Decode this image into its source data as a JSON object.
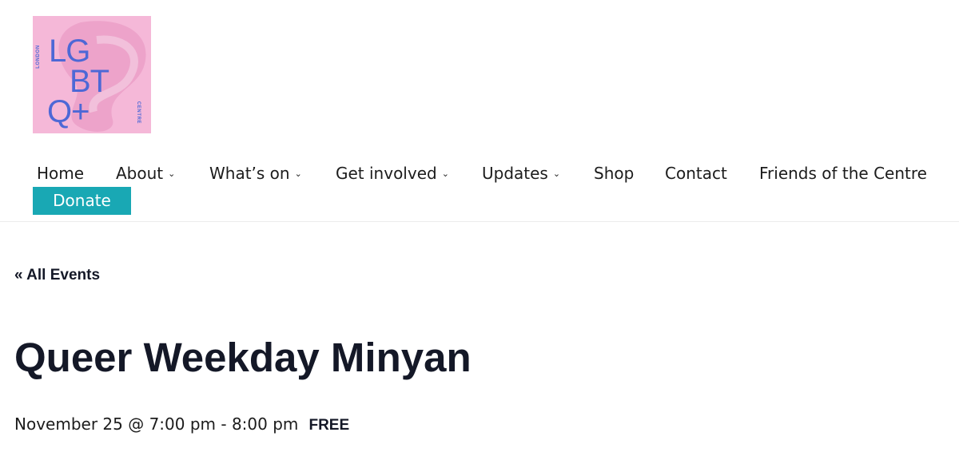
{
  "header": {
    "logo": {
      "row1": "LG",
      "row2": "BT",
      "row3": "Q+",
      "side_left": "LONDON",
      "side_right": "CENTRE",
      "background_color": "#f5b8d8",
      "letter_color": "#4d68d6"
    }
  },
  "nav": {
    "items": [
      {
        "label": "Home",
        "has_dropdown": false
      },
      {
        "label": "About",
        "has_dropdown": true
      },
      {
        "label": "What’s on",
        "has_dropdown": true
      },
      {
        "label": "Get involved",
        "has_dropdown": true
      },
      {
        "label": "Updates",
        "has_dropdown": true
      },
      {
        "label": "Shop",
        "has_dropdown": false
      },
      {
        "label": "Contact",
        "has_dropdown": false
      },
      {
        "label": "Friends of the Centre",
        "has_dropdown": false
      }
    ],
    "donate_label": "Donate",
    "donate_color": "#19a8b4"
  },
  "event": {
    "back_link": "« All Events",
    "title": "Queer Weekday Minyan",
    "datetime": "November 25 @ 7:00 pm - 8:00 pm",
    "cost": "FREE"
  }
}
